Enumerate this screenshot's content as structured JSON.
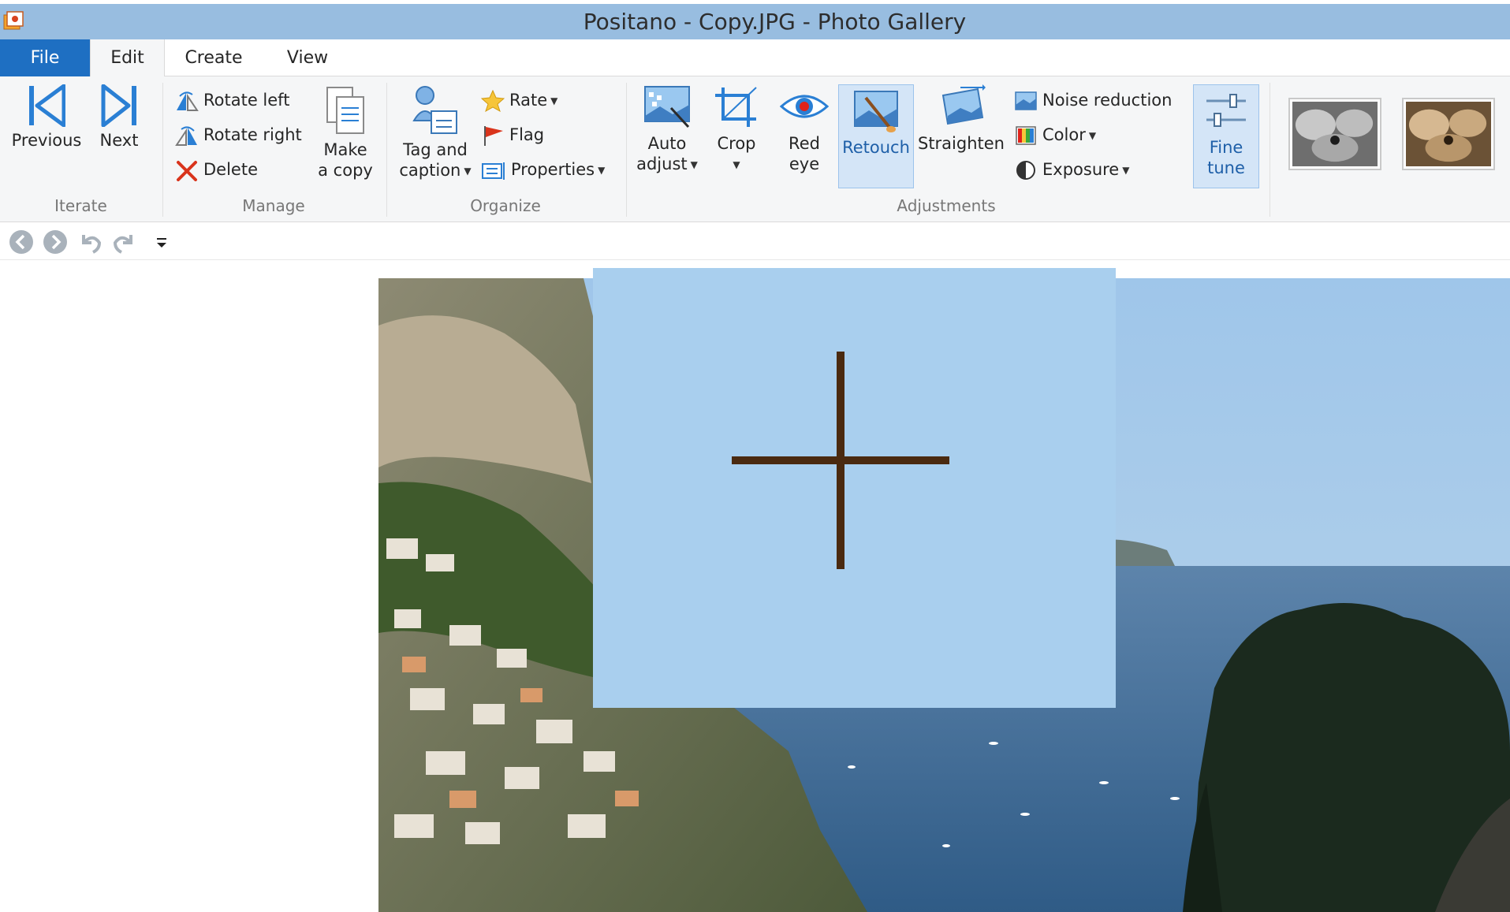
{
  "window": {
    "title": "Positano - Copy.JPG - Photo Gallery",
    "app_icon": "photo-gallery-icon"
  },
  "tabs": [
    {
      "label": "File"
    },
    {
      "label": "Edit"
    },
    {
      "label": "Create"
    },
    {
      "label": "View"
    }
  ],
  "ribbon": {
    "iterate": {
      "label": "Iterate",
      "previous": "Previous",
      "next": "Next"
    },
    "manage": {
      "label": "Manage",
      "rotate_left": "Rotate left",
      "rotate_right": "Rotate right",
      "delete": "Delete",
      "make_copy_line1": "Make",
      "make_copy_line2": "a copy"
    },
    "organize": {
      "label": "Organize",
      "tag_line1": "Tag and",
      "tag_line2": "caption",
      "rate": "Rate",
      "flag": "Flag",
      "properties": "Properties"
    },
    "adjustments": {
      "label": "Adjustments",
      "auto_line1": "Auto",
      "auto_line2": "adjust",
      "crop": "Crop",
      "red_line1": "Red",
      "red_line2": "eye",
      "retouch": "Retouch",
      "straighten": "Straighten",
      "noise_reduction": "Noise reduction",
      "color": "Color",
      "exposure": "Exposure",
      "fine_line1": "Fine",
      "fine_line2": "tune"
    }
  },
  "colors": {
    "titlebar": "#98bde0",
    "file_tab": "#1e6fc2",
    "accent_blue": "#2a7fd4",
    "retouch_box": "#a9cfee",
    "crosshair": "#4a2a10"
  }
}
